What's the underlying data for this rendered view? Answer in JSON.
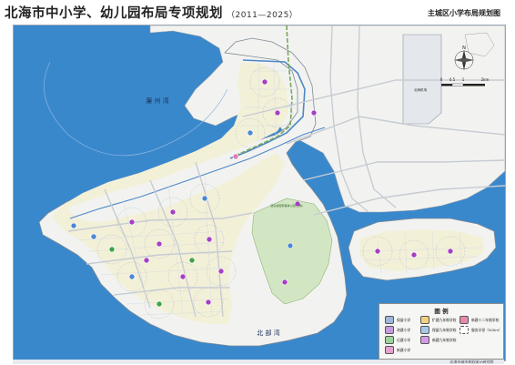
{
  "header": {
    "title": "北海市中小学、幼儿园布局专项规划",
    "period": "（2011—2025）",
    "subtitle": "主城区小学布局规划图"
  },
  "map": {
    "bay_north": "廉  州  湾",
    "bay_south": "北  部  湾",
    "airport": "北海机场",
    "park_label": "冠头岭国家森林公园(二期)",
    "scale_labels": [
      "0",
      "0.5",
      "1",
      "2km"
    ],
    "north_symbol": "N",
    "colors": {
      "sea": "#3a88cc",
      "land": "#f2f3f0",
      "urban": "#f3f0d8",
      "park": "#d3e6c3",
      "road": "#c7ccd3",
      "district_road": "#4e87c8",
      "green_belt": "#79a85a",
      "school_purple": "#a63fc4",
      "school_blue": "#4b86d8",
      "school_green": "#3ea348",
      "school_pink": "#e07ab4"
    }
  },
  "legend": {
    "title": "图  例",
    "items": [
      {
        "label": "保留小学",
        "color": "#9fb7d9"
      },
      {
        "label": "改建小学",
        "color": "#c79be0"
      },
      {
        "label": "迁建小学",
        "color": "#9fd39b"
      },
      {
        "label": "新建小学",
        "color": "#e6a1cf"
      },
      {
        "label": "扩建九年制学校",
        "color": "#f2d27e"
      },
      {
        "label": "保留九年制学校",
        "color": "#a7c7e8"
      },
      {
        "label": "新建九年制学校",
        "color": "#d39be6"
      },
      {
        "label": "新建十二年制学校",
        "color": "#e68ab0"
      },
      {
        "label": "服务半径（500m）",
        "color": "#ffffff"
      }
    ]
  },
  "footer": {
    "text": "北海市城市规划设计研究院"
  }
}
